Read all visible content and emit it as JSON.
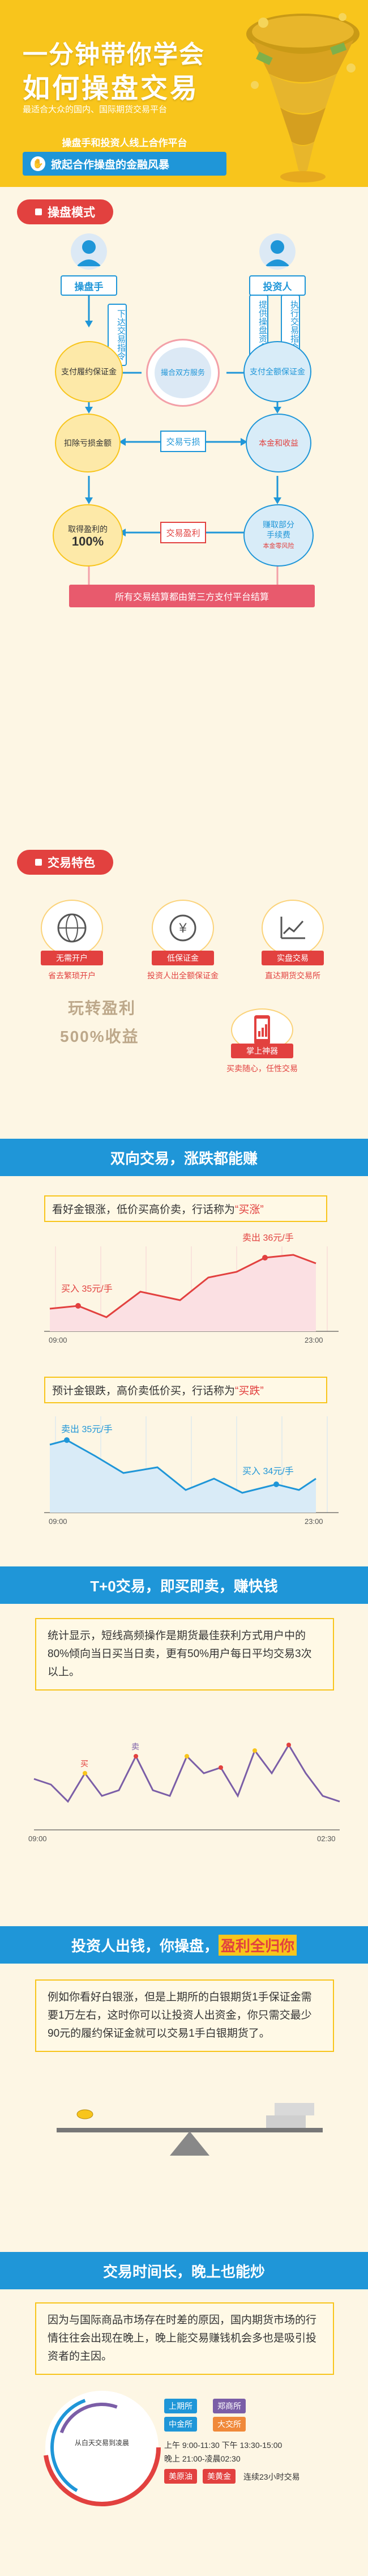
{
  "hero": {
    "title_line1": "一分钟带你学会",
    "title_line2": "如何操盘交易",
    "subtitle": "最适合大众的国内、国际期货交易平台",
    "tagline": "操盘手和投资人线上合作平台",
    "ribbon": "掀起合作操盘的金融风暴"
  },
  "flow": {
    "header": "操盘模式",
    "left_person": "操盘手",
    "right_person": "投资人",
    "left_vertical": "下达交易指令",
    "right_vertical1": "提供操盘资金",
    "right_vertical2": "执行交易指令",
    "left_circle1": "支付履约保证金",
    "center_circle": "撮合双方服务",
    "right_circle1": "支付全额保证金",
    "left_circle2": "扣除亏损金额",
    "right_circle2": "本金和收益",
    "right_circle2_sub": "",
    "left_circle3_line1": "取得盈利的",
    "left_circle3_line2": "100%",
    "right_circle3_line1": "赚取部分",
    "right_circle3_line2": "手续费",
    "right_circle3_sub": "本金零风险",
    "mid_box1": "交易亏损",
    "mid_box2": "交易盈利",
    "bottom_bar": "所有交易结算都由第三方支付平台结算"
  },
  "features": {
    "header": "交易特色",
    "items": [
      {
        "tag": "无需开户",
        "desc": "省去繁琐开户"
      },
      {
        "tag": "低保证金",
        "desc": "投资人出全额保证金"
      },
      {
        "tag": "实盘交易",
        "desc": "直达期货交易所"
      }
    ],
    "big1": "玩转盈利",
    "big2": "500%收益",
    "phone_tag": "掌上神器",
    "phone_desc": "买卖随心，任性交易"
  },
  "twoway": {
    "banner": "双向交易，涨跌都能赚",
    "quote1_text": "看好金银涨，低价买高价卖，行话称为",
    "quote1_hl": "“买涨”",
    "chart1": {
      "buy": "买入 35元/手",
      "sell": "卖出 36元/手",
      "t0": "09:00",
      "t1": "23:00"
    },
    "quote2_text": "预计金银跌，高价卖低价买，行话称为",
    "quote2_hl": "“买跌”",
    "chart2": {
      "sell": "卖出 35元/手",
      "buy": "买入 34元/手",
      "t0": "09:00",
      "t1": "23:00"
    }
  },
  "t0": {
    "banner": "T+0交易，即买即卖，赚快钱",
    "para": "统计显示，短线高频操作是期货最佳获利方式用户中的80%倾向当日买当日卖，更有50%用户每日平均交易3次以上。",
    "t0": "09:00",
    "t1": "02:30",
    "buy_lbl": "买",
    "sell_lbl": "卖"
  },
  "invest": {
    "banner_a": "投资人出钱，你操盘，",
    "banner_hl": "盈利全归你",
    "para": "例如你看好白银涨，但是上期所的白银期货1手保证金需要1万左右，这时你可以让投资人出资金，你只需交最少90元的履约保证金就可以交易1手白银期货了。"
  },
  "hours": {
    "banner": "交易时间长，晚上也能炒",
    "para": "因为与国际商品市场存在时差的原因，国内期货市场的行情往往会出现在晚上，晚上能交易赚钱机会多也是吸引投资者的主因。",
    "clock_center": "从白天交易到凌晨",
    "exchanges": [
      "上期所",
      "郑商所",
      "中金所",
      "大交所",
      "美原油",
      "美黄金"
    ],
    "time_line1": "上午 9:00-11:30  下午 13:30-15:00",
    "time_line2": "晚上 21:00-凌晨02:30",
    "time_line3": "连续23小时交易"
  },
  "colors": {
    "yellow": "#f8c51c",
    "red": "#e2413f",
    "blue": "#1f96d8",
    "cream": "#fdf6e4"
  }
}
